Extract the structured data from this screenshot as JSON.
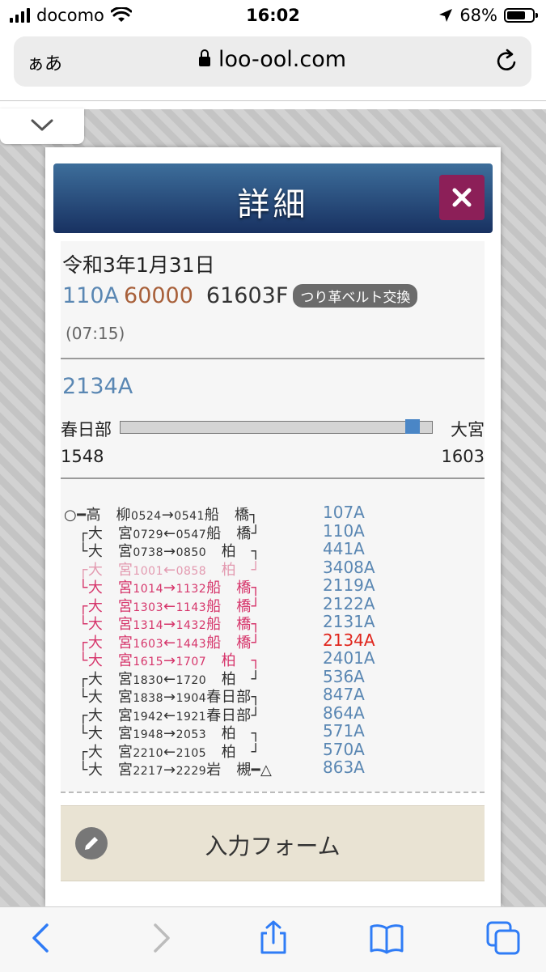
{
  "status": {
    "carrier": "docomo",
    "time": "16:02",
    "battery": "68%"
  },
  "browser": {
    "aa_label": "ぁあ",
    "url": "loo-ool.com"
  },
  "detail": {
    "title": "詳細",
    "date": "令和3年1月31日",
    "train_code": "110A",
    "car_number": "60000",
    "formation": "61603F",
    "badge": "つり革ベルト交換",
    "sub_time": "(07:15)",
    "current_run": "2134A",
    "from_station": "春日部",
    "to_station": "大宮",
    "from_time": "1548",
    "to_time": "1603",
    "progress": 0.96
  },
  "schedule": [
    {
      "line": "○━高　柳<small>0524</small>→<small>0541</small>船　橋┐",
      "code": "107A",
      "style": "normal"
    },
    {
      "line": "　┌大　宮<small>0729</small>←<small>0547</small>船　橋┘",
      "code": "110A",
      "style": "normal"
    },
    {
      "line": "　└大　宮<small>0738</small>→<small>0850</small>　柏　┐",
      "code": "441A",
      "style": "normal"
    },
    {
      "line": "　┌大　宮<small>1001</small>←<small>0858</small>　柏　┘",
      "code": "3408A",
      "style": "pink"
    },
    {
      "line": "　└大　宮<small>1014</small>→<small>1132</small>船　橋┐",
      "code": "2119A",
      "style": "red"
    },
    {
      "line": "　┌大　宮<small>1303</small>←<small>1143</small>船　橋┘",
      "code": "2122A",
      "style": "red"
    },
    {
      "line": "　└大　宮<small>1314</small>→<small>1432</small>船　橋┐",
      "code": "2131A",
      "style": "red"
    },
    {
      "line": "　┌大　宮<small>1603</small>←<small>1443</small>船　橋┘",
      "code": "2134A",
      "style": "red-current"
    },
    {
      "line": "　└大　宮<small>1615</small>→<small>1707</small>　柏　┐",
      "code": "2401A",
      "style": "red"
    },
    {
      "line": "　┌大　宮<small>1830</small>←<small>1720</small>　柏　┘",
      "code": "536A",
      "style": "normal"
    },
    {
      "line": "　└大　宮<small>1838</small>→<small>1904</small>春日部┐",
      "code": "847A",
      "style": "normal"
    },
    {
      "line": "　┌大　宮<small>1942</small>←<small>1921</small>春日部┘",
      "code": "864A",
      "style": "normal"
    },
    {
      "line": "　└大　宮<small>1948</small>→<small>2053</small>　柏　┐",
      "code": "571A",
      "style": "normal"
    },
    {
      "line": "　┌大　宮<small>2210</small>←<small>2105</small>　柏　┘",
      "code": "570A",
      "style": "normal"
    },
    {
      "line": "　└大　宮<small>2217</small>→<small>2229</small>岩　槻━△",
      "code": "863A",
      "style": "normal"
    }
  ],
  "form": {
    "label": "入力フォーム"
  },
  "icons": [
    "signal-icon",
    "wifi-icon",
    "location-icon",
    "battery-icon",
    "lock-icon",
    "reload-icon",
    "chevron-down-icon",
    "close-icon",
    "pencil-icon",
    "back-icon",
    "forward-icon",
    "share-icon",
    "bookmarks-icon",
    "tabs-icon"
  ]
}
